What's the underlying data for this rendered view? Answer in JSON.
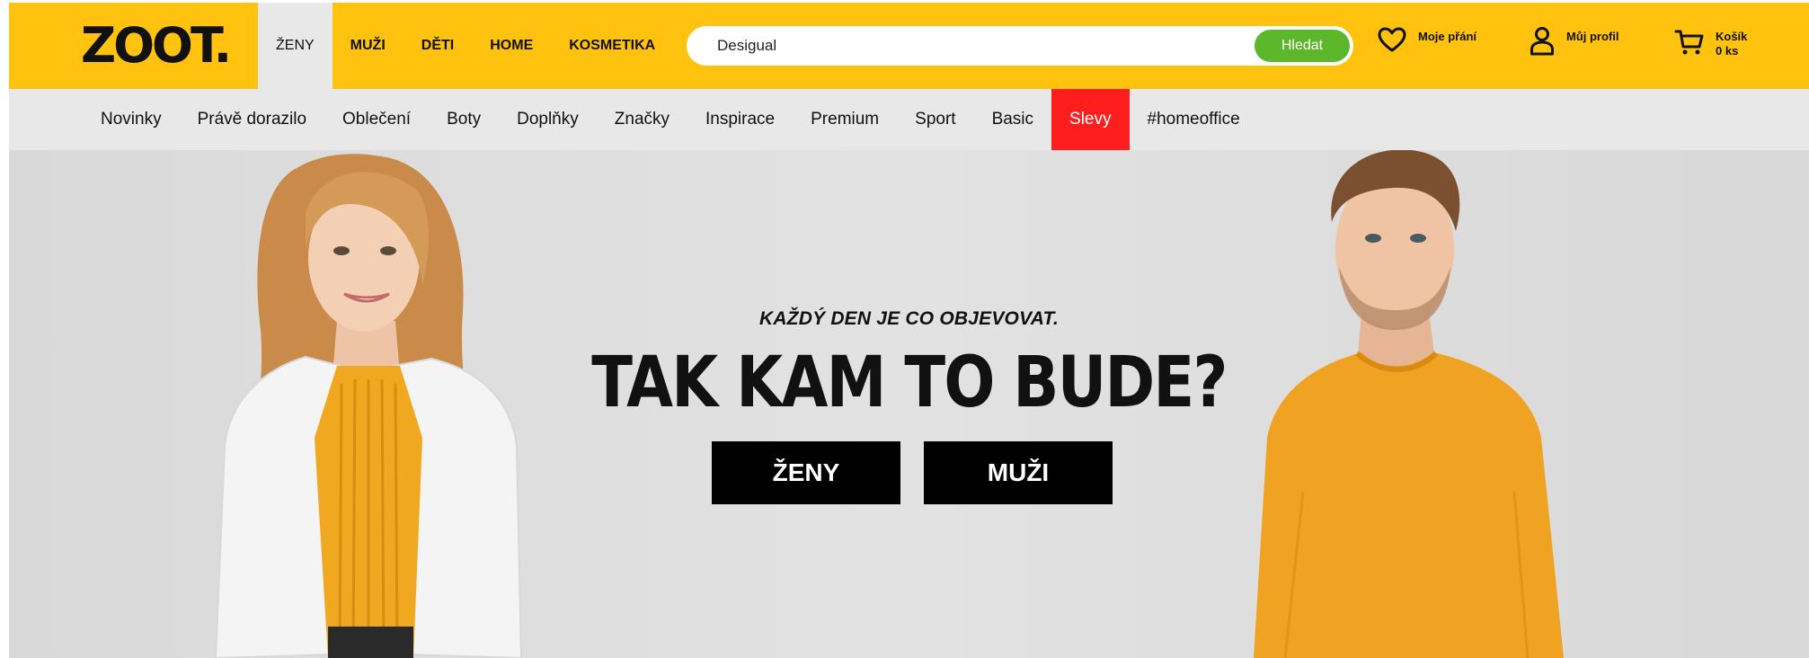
{
  "header": {
    "logo": "ZOOT.",
    "gender_tabs": [
      {
        "label": "ŽENY",
        "active": true
      },
      {
        "label": "MUŽI",
        "active": false
      },
      {
        "label": "DĚTI",
        "active": false
      },
      {
        "label": "HOME",
        "active": false
      },
      {
        "label": "KOSMETIKA",
        "active": false
      }
    ],
    "search": {
      "value": "Desigual",
      "button_label": "Hledat"
    },
    "wishlist_label": "Moje přání",
    "profile_label": "Můj profil",
    "cart": {
      "label": "Košík",
      "count": "0 ks"
    }
  },
  "categories": [
    {
      "label": "Novinky"
    },
    {
      "label": "Právě dorazilo"
    },
    {
      "label": "Oblečení"
    },
    {
      "label": "Boty"
    },
    {
      "label": "Doplňky"
    },
    {
      "label": "Značky"
    },
    {
      "label": "Inspirace"
    },
    {
      "label": "Premium"
    },
    {
      "label": "Sport"
    },
    {
      "label": "Basic"
    },
    {
      "label": "Slevy",
      "highlight": true
    },
    {
      "label": "#homeoffice"
    }
  ],
  "hero": {
    "subtitle": "KAŽDÝ DEN JE CO OBJEVOVAT.",
    "title": "TAK KAM TO BUDE?",
    "women_button": "ŽENY",
    "men_button": "MUŽI"
  },
  "colors": {
    "brand_yellow": "#ffc20e",
    "nav_gray": "#e8e8e8",
    "sale_red": "#ff1e1e",
    "search_green": "#5cb82a"
  },
  "icons": {
    "wishlist": "heart-icon",
    "profile": "user-icon",
    "cart": "cart-icon"
  }
}
